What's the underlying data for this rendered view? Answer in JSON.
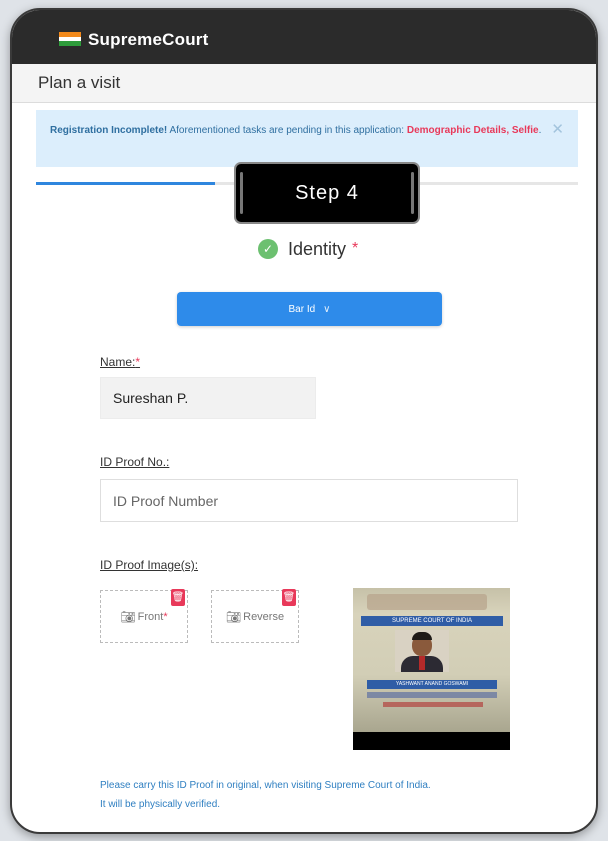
{
  "app": {
    "title": "SupremeCourt",
    "flag_icon": "india-flag-icon"
  },
  "page": {
    "title": "Plan a visit"
  },
  "alert": {
    "strong": "Registration Incomplete!",
    "message": " Aforementioned tasks are pending in this application: ",
    "pending_tasks": "Demographic Details, Selfie",
    "end": ".",
    "close_icon": "close-icon"
  },
  "progress": {
    "fraction": 0.33
  },
  "step": {
    "label": "Step  4"
  },
  "identity": {
    "label": "Identity",
    "required_mark": "*",
    "icon": "check-circle-icon"
  },
  "id_type": {
    "selected": "Bar Id",
    "chevron": "∨"
  },
  "form": {
    "name_label": "Name:",
    "name_required": "*",
    "name_value": "Sureshan P.",
    "id_proof_no_label": "ID Proof No.:",
    "id_proof_no_placeholder": "ID Proof Number",
    "id_proof_images_label": "ID Proof Image(s):"
  },
  "uploads": {
    "front_label": "Front",
    "front_required": "*",
    "reverse_label": "Reverse",
    "camera_icon": "camera-icon",
    "delete_icon": "trash-icon"
  },
  "id_card": {
    "header_text": "SUPREME COURT OF INDIA",
    "name_text": "YASHWANT ANAND GOSWAMI"
  },
  "note": {
    "line1": "Please carry this ID Proof in original, when visiting Supreme Court of India.",
    "line2": "It will be physically verified."
  },
  "colors": {
    "accent": "#2e8bea",
    "danger": "#e8395a",
    "alert_bg": "#dceefc",
    "topbar": "#2b2b2b",
    "success": "#6cc070"
  }
}
